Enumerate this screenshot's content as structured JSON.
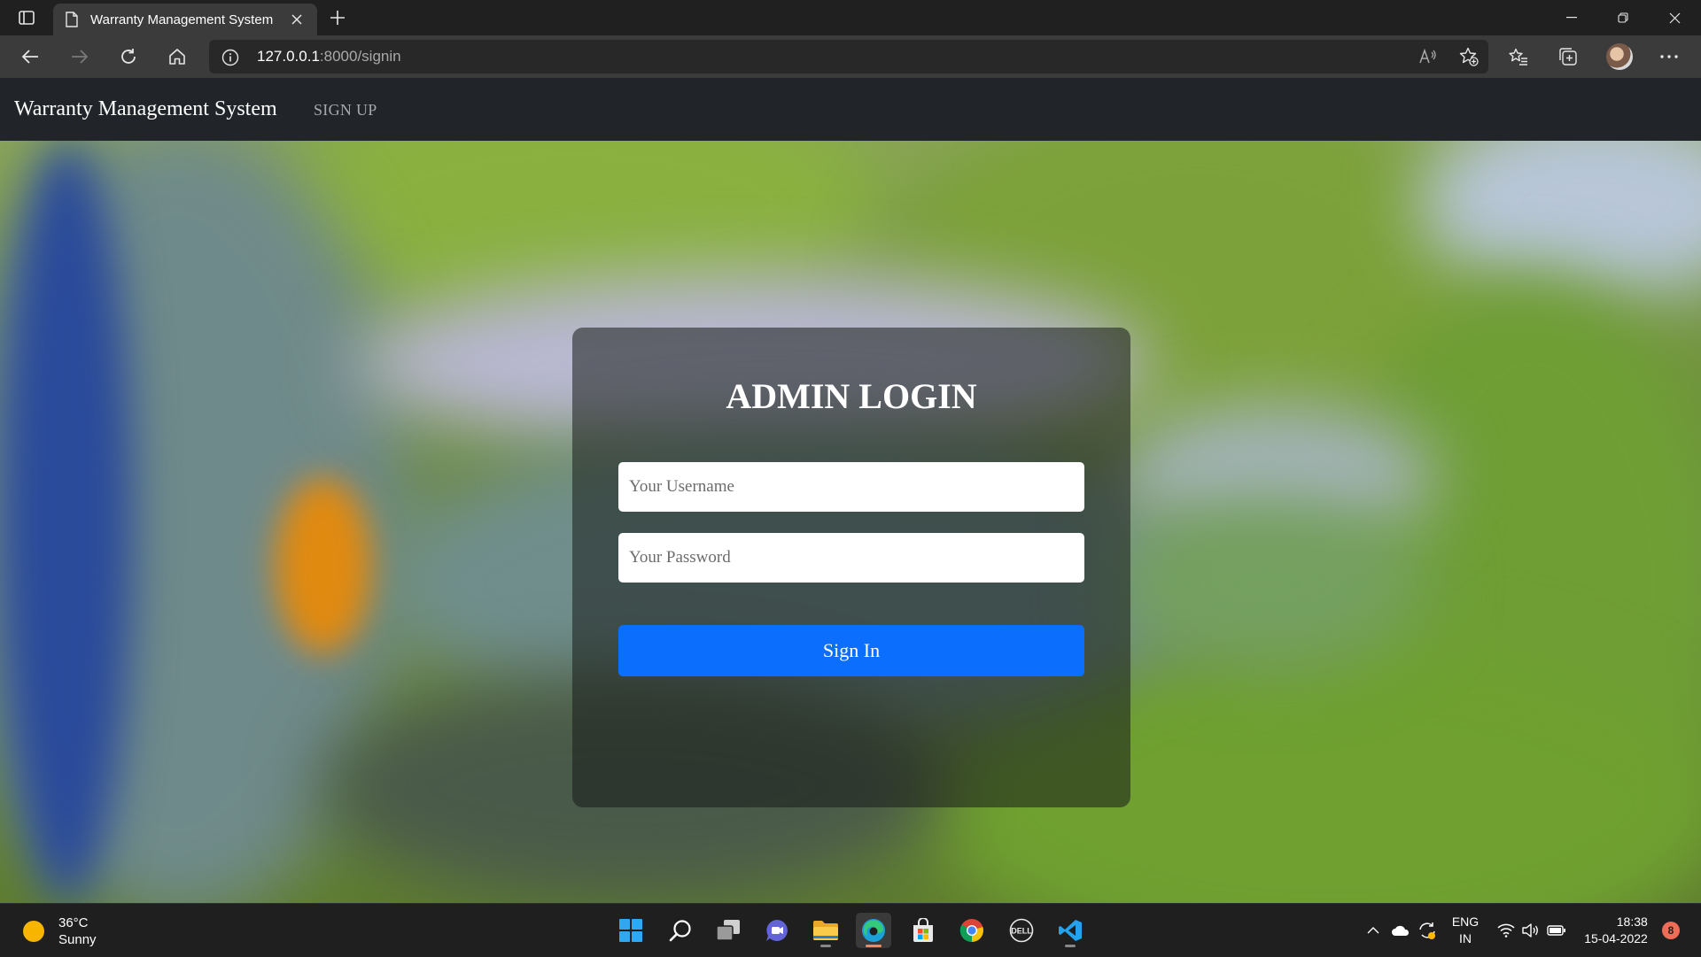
{
  "browser": {
    "tab_title": "Warranty Management System",
    "url_host": "127.0.0.1",
    "url_rest": ":8000/signin"
  },
  "navbar": {
    "brand": "Warranty Management System",
    "signup_link": "SIGN UP"
  },
  "login": {
    "title": "ADMIN LOGIN",
    "username_placeholder": "Your Username",
    "password_placeholder": "Your Password",
    "signin_label": "Sign In",
    "button_color": "#0b6efd"
  },
  "taskbar": {
    "weather_temp": "36°C",
    "weather_desc": "Sunny",
    "lang_primary": "ENG",
    "lang_secondary": "IN",
    "time": "18:38",
    "date": "15-04-2022",
    "notification_count": "8",
    "apps": [
      "start-icon",
      "search-icon",
      "task-view-icon",
      "chat-icon",
      "file-explorer-icon",
      "edge-icon",
      "store-icon",
      "chrome-icon",
      "dell-icon",
      "vscode-icon"
    ]
  }
}
